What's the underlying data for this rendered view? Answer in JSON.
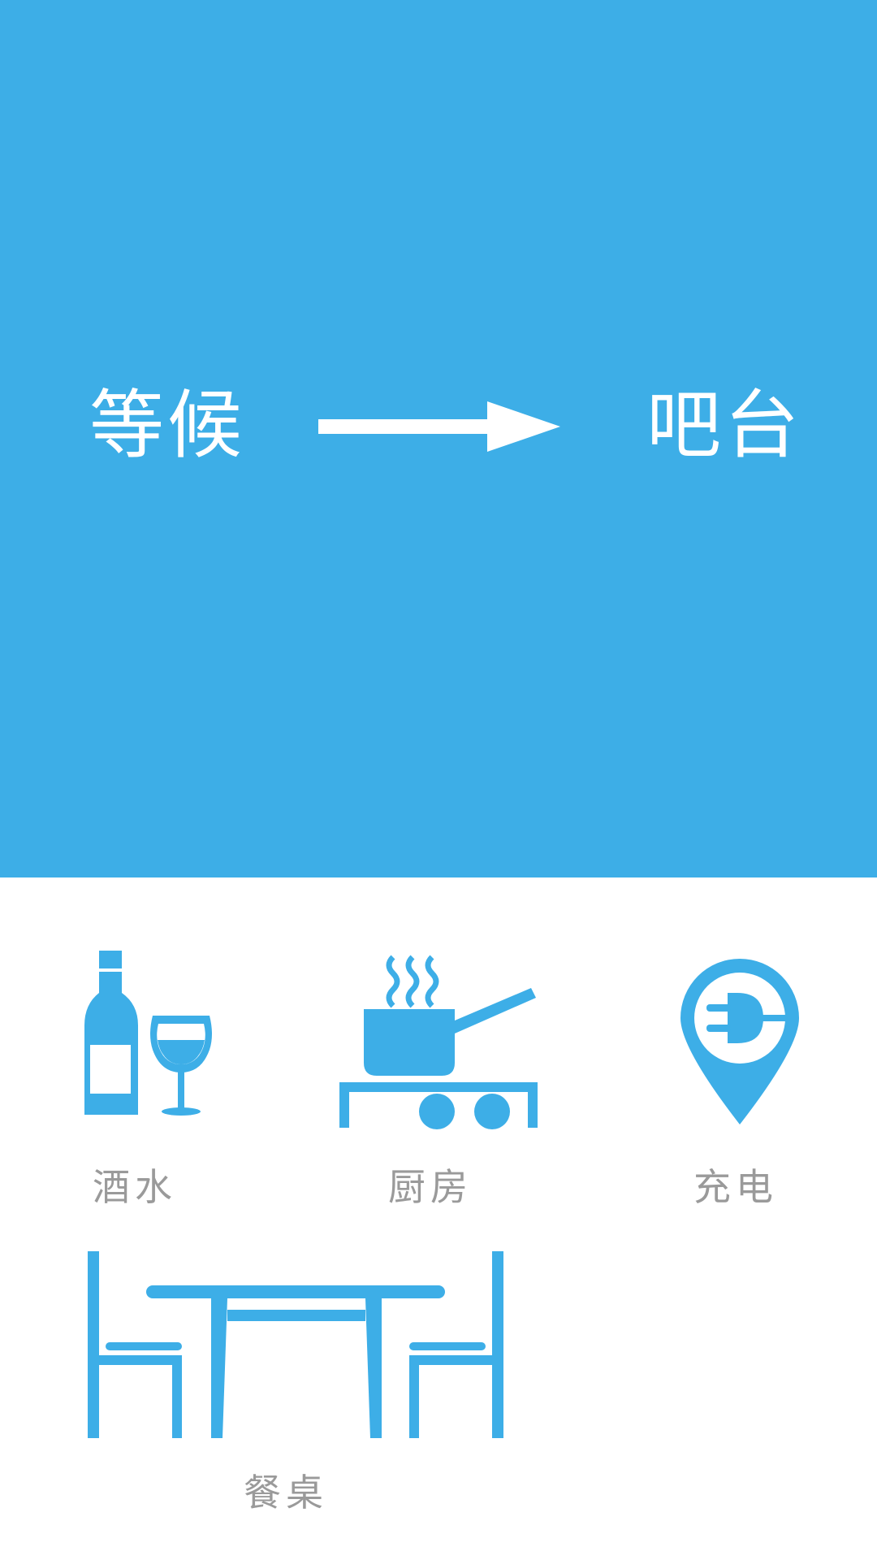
{
  "hero": {
    "from_label": "等候",
    "to_label": "吧台",
    "background_color": "#3daee7",
    "arrow_icon": "right-arrow-icon"
  },
  "tiles": [
    {
      "label": "酒水",
      "icon": "wine-bottle-glass-icon"
    },
    {
      "label": "厨房",
      "icon": "cooking-pot-stove-icon"
    },
    {
      "label": "充电",
      "icon": "charging-plug-pin-icon"
    },
    {
      "label": "餐桌",
      "icon": "dining-table-chairs-icon"
    }
  ],
  "colors": {
    "accent": "#3daee7",
    "label": "#9a9a9a",
    "background": "#ffffff"
  }
}
